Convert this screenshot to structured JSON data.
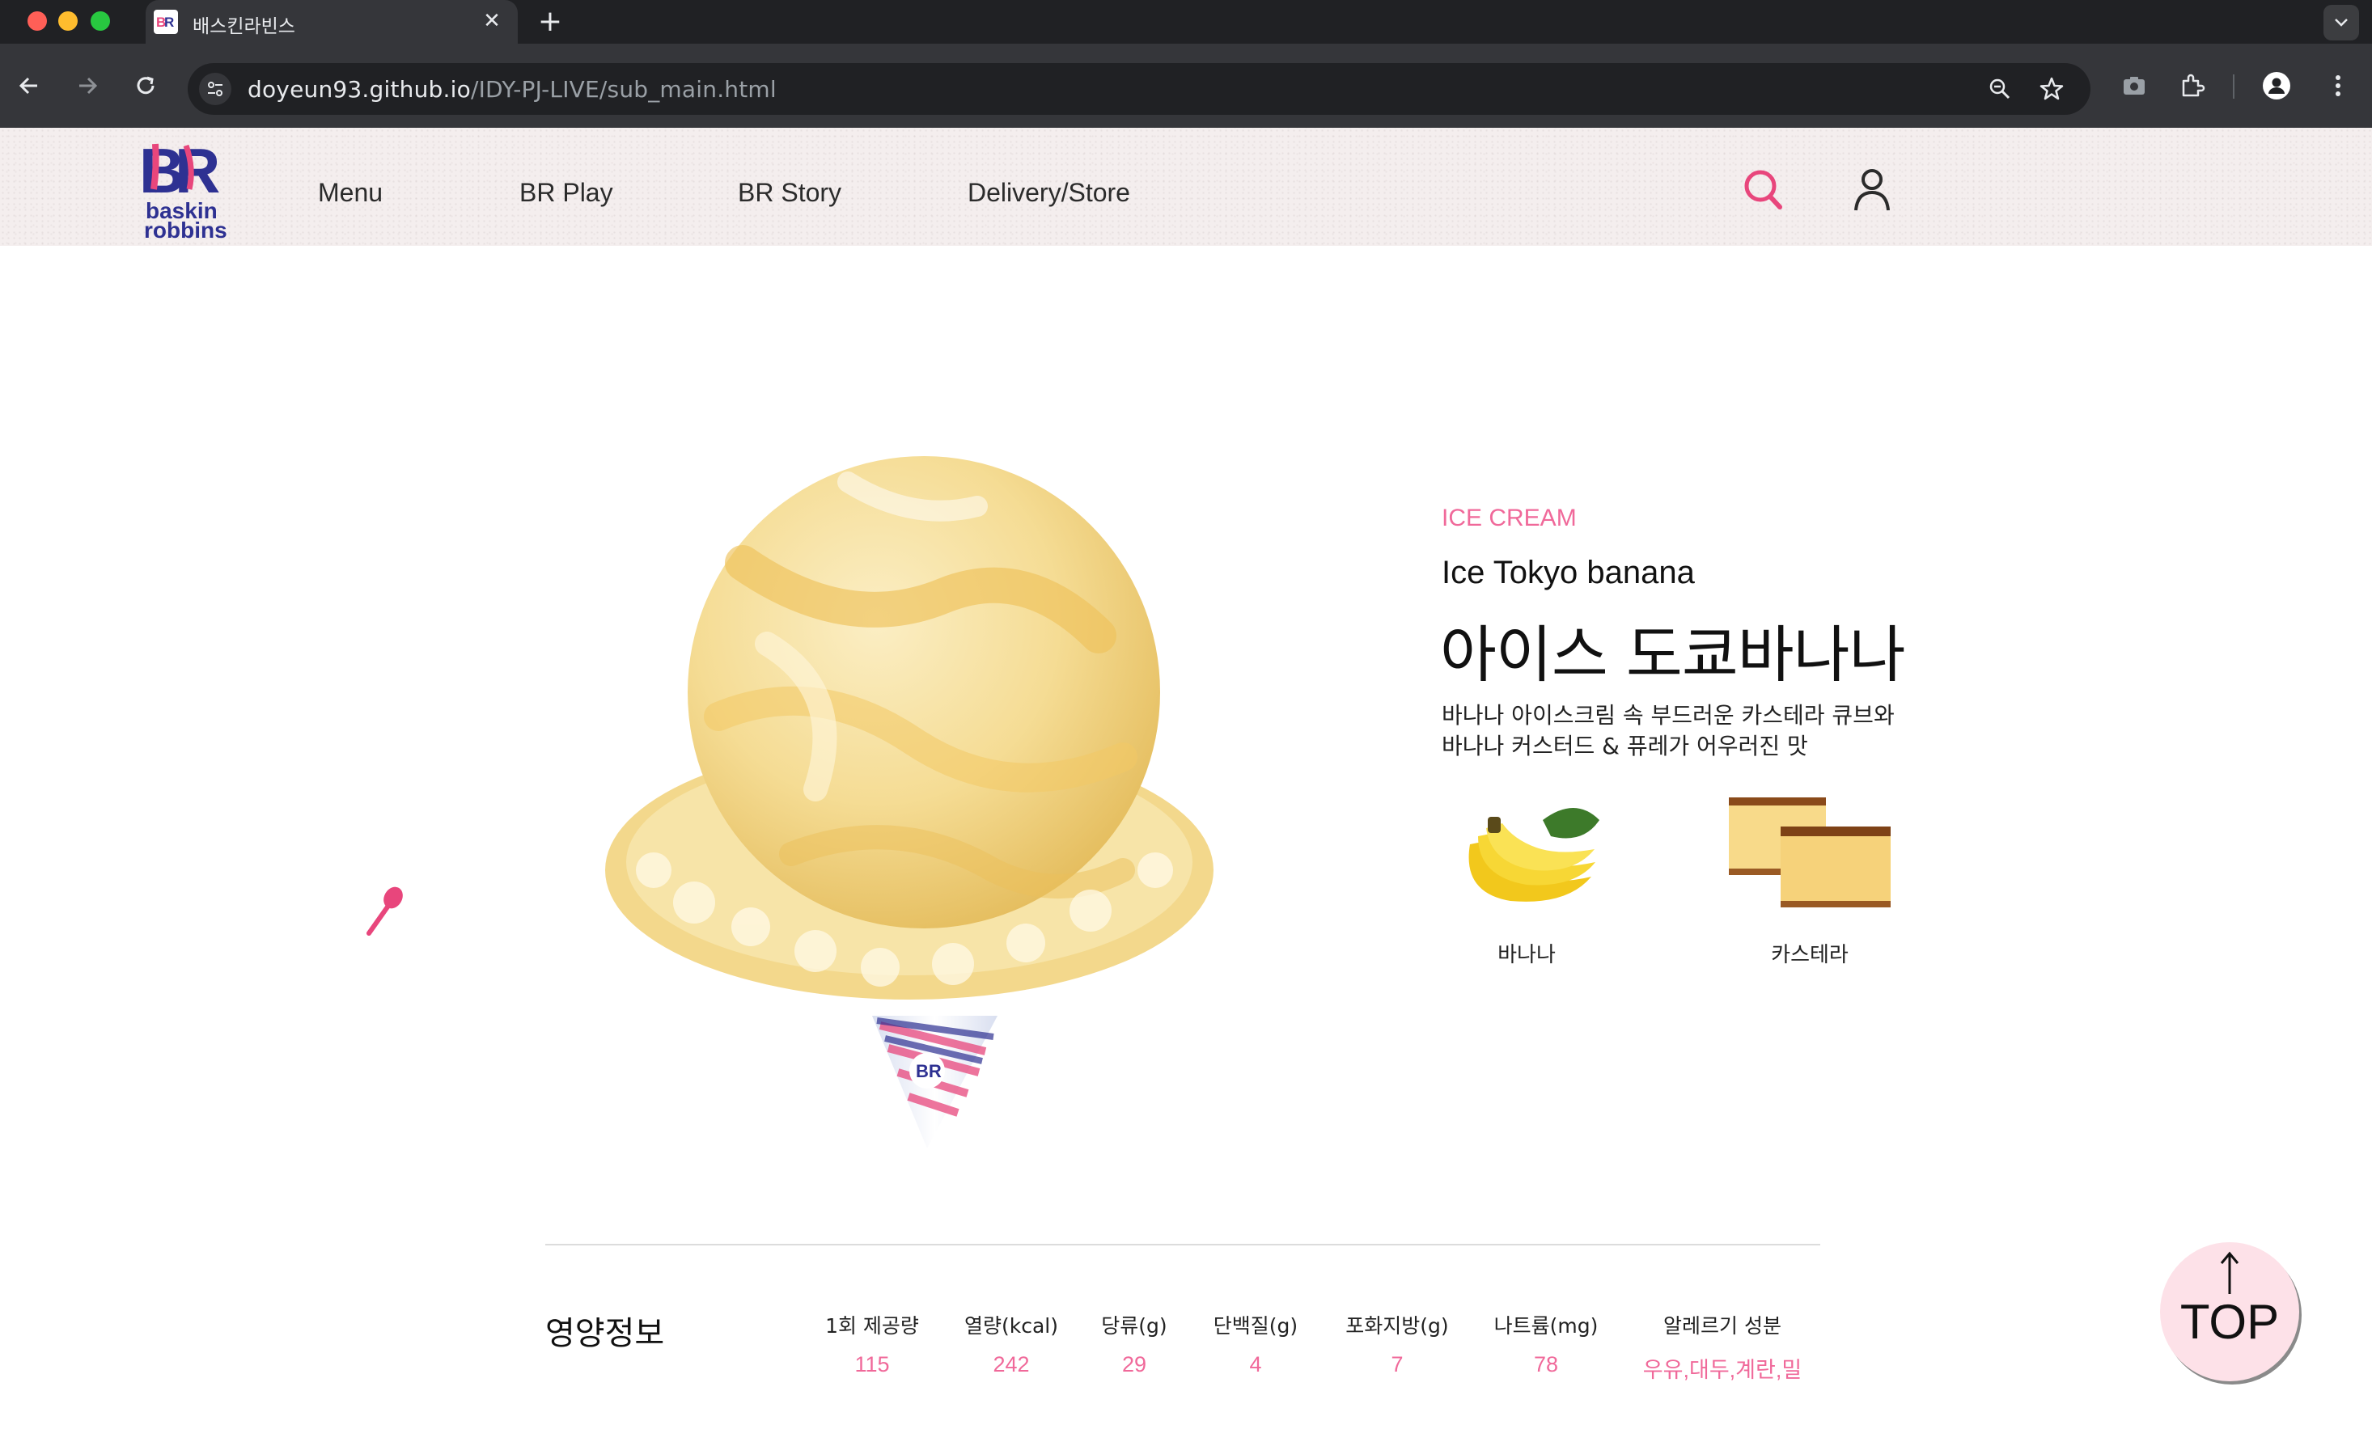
{
  "browser": {
    "tab_title": "배스킨라빈스",
    "url_host": "doyeun93.github.io",
    "url_path": "/IDY-PJ-LIVE/sub_main.html",
    "icons": [
      "back-icon",
      "forward-icon",
      "reload-icon",
      "site-settings-icon",
      "zoom-icon",
      "bookmark-star-icon",
      "camera-icon",
      "extensions-icon",
      "profile-icon",
      "more-menu-icon",
      "tab-close-icon",
      "new-tab-icon",
      "tab-list-icon"
    ]
  },
  "header": {
    "nav": [
      {
        "label": "Menu"
      },
      {
        "label": "BR Play"
      },
      {
        "label": "BR Story"
      },
      {
        "label": "Delivery/Store"
      }
    ],
    "icons": [
      "search-icon",
      "user-icon"
    ],
    "colors": {
      "accent": "#f0699a",
      "header_bg": "#f4eeee"
    }
  },
  "product": {
    "category": "ICE CREAM",
    "name_en": "Ice Tokyo banana",
    "name_ko": "아이스 도쿄바나나",
    "description": "바나나 아이스크림 속 부드러운 카스테라 큐브와 바나나 커스터드 & 퓨레가 어우러진 맛",
    "ingredients": [
      {
        "label": "바나나",
        "icon": "banana-icon"
      },
      {
        "label": "카스테라",
        "icon": "castella-icon"
      }
    ]
  },
  "nutrition": {
    "title": "영양정보",
    "columns": [
      {
        "label": "1회 제공량",
        "value": "115"
      },
      {
        "label": "열량(kcal)",
        "value": "242"
      },
      {
        "label": "당류(g)",
        "value": "29"
      },
      {
        "label": "단백질(g)",
        "value": "4"
      },
      {
        "label": "포화지방(g)",
        "value": "7"
      },
      {
        "label": "나트륨(mg)",
        "value": "78"
      },
      {
        "label": "알레르기 성분",
        "value": "우유,대두,계란,밀"
      }
    ]
  },
  "top_button": {
    "label": "TOP"
  }
}
